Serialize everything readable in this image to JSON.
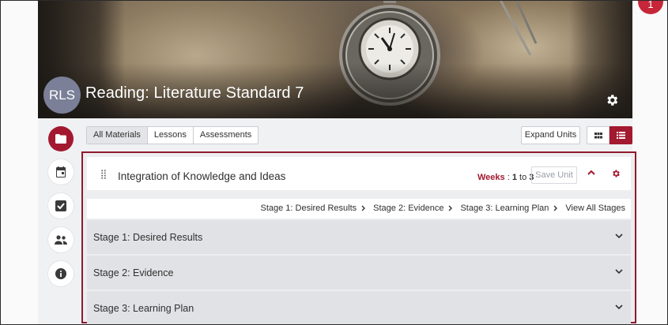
{
  "course": {
    "avatar_initials": "RLS",
    "title": "Reading: Literature Standard 7"
  },
  "notification": {
    "text": "1"
  },
  "rail": [
    {
      "name": "folder-icon",
      "active": true
    },
    {
      "name": "calendar-icon",
      "active": false
    },
    {
      "name": "checkbox-icon",
      "active": false
    },
    {
      "name": "people-icon",
      "active": false
    },
    {
      "name": "info-icon",
      "active": false
    }
  ],
  "toolbar": {
    "filters": [
      "All Materials",
      "Lessons",
      "Assessments"
    ],
    "active_filter": "All Materials",
    "expand_label": "Expand Units"
  },
  "unit": {
    "title": "Integration of Knowledge and Ideas",
    "weeks_label": "Weeks",
    "weeks_sep": " : ",
    "weeks_from": "1",
    "weeks_to_word": " to ",
    "weeks_to": "3",
    "save_label": "Save Unit",
    "stage_links": [
      "Stage 1: Desired Results",
      "Stage 2: Evidence",
      "Stage 3: Learning Plan"
    ],
    "view_all_label": "View All Stages",
    "stages": [
      "Stage 1: Desired Results",
      "Stage 2: Evidence",
      "Stage 3: Learning Plan"
    ]
  },
  "colors": {
    "accent": "#a3192f",
    "unit_border": "#8f1a2c",
    "avatar": "#7b7f97",
    "notification": "#c7263a"
  }
}
